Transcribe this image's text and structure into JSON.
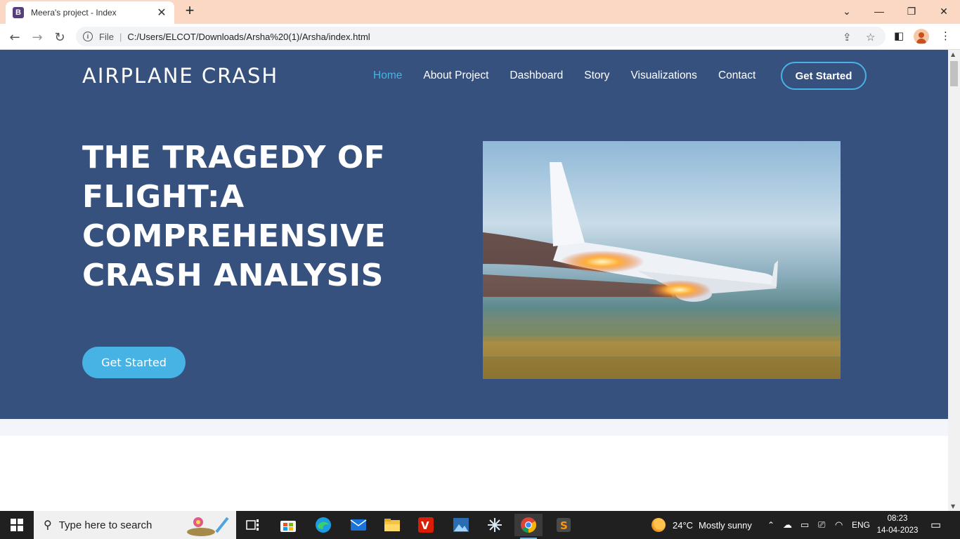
{
  "browser": {
    "tab_title": "Meera's project - Index",
    "tab_favicon_letter": "B",
    "address_scheme": "File",
    "address_url": "C:/Users/ELCOT/Downloads/Arsha%20(1)/Arsha/index.html"
  },
  "site": {
    "brand": "AIRPLANE CRASH",
    "nav": [
      "Home",
      "About Project",
      "Dashboard",
      "Story",
      "Visualizations",
      "Contact"
    ],
    "nav_active": "Home",
    "nav_cta": "Get Started",
    "headline": "THE TRAGEDY OF FLIGHT:A COMPREHENSIVE CRASH ANALYSIS",
    "hero_cta": "Get Started",
    "colors": {
      "hero_bg": "#37517e",
      "accent": "#47b2e4"
    }
  },
  "taskbar": {
    "search_placeholder": "Type here to search",
    "weather_temp": "24°C",
    "weather_text": "Mostly sunny",
    "language": "ENG",
    "time": "08:23",
    "date": "14-04-2023"
  }
}
